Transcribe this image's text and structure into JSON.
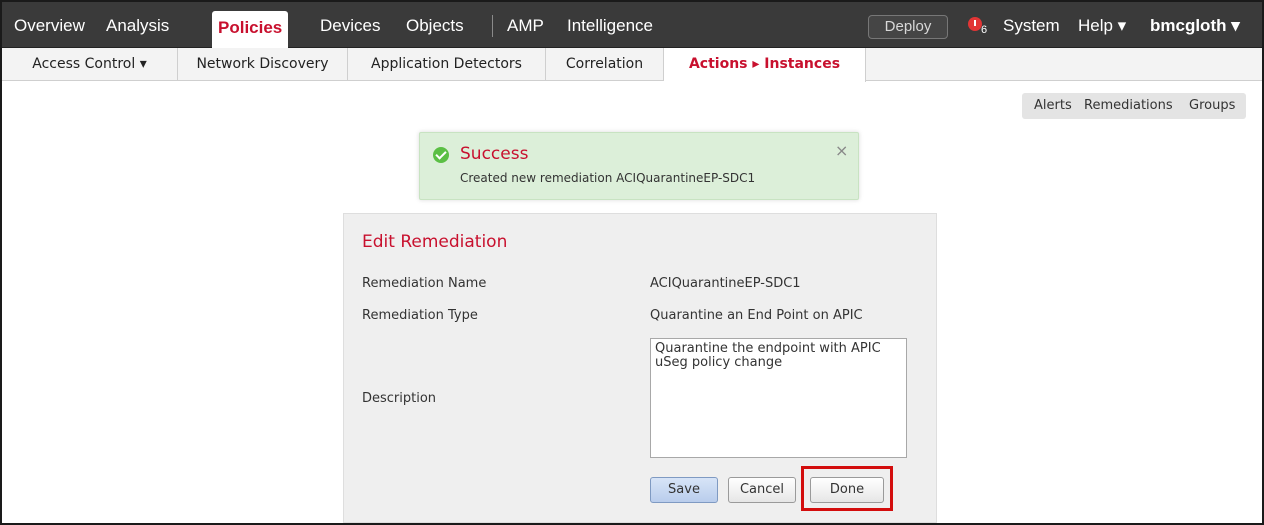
{
  "topnav": {
    "items": [
      "Overview",
      "Analysis",
      "Policies",
      "Devices",
      "Objects",
      "AMP",
      "Intelligence"
    ],
    "active": "Policies",
    "deploy_label": "Deploy",
    "alert_count": "6",
    "system_label": "System",
    "help_label": "Help ▾",
    "user_label": "bmcgloth ▾"
  },
  "subnav": {
    "tabs": [
      "Access Control ▾",
      "Network Discovery",
      "Application Detectors",
      "Correlation",
      "Actions ▸ Instances"
    ],
    "active": "Actions ▸ Instances"
  },
  "page_actions": [
    "Alerts",
    "Remediations",
    "Groups"
  ],
  "success": {
    "title": "Success",
    "message": "Created new remediation ACIQuarantineEP-SDC1",
    "close": "×"
  },
  "form": {
    "title": "Edit Remediation",
    "fields": [
      {
        "label": "Remediation Name",
        "value": "ACIQuarantineEP-SDC1"
      },
      {
        "label": "Remediation Type",
        "value": "Quarantine an End Point on APIC"
      },
      {
        "label": "Description",
        "value": "Quarantine the endpoint with APIC uSeg policy change"
      }
    ],
    "buttons": {
      "save": "Save",
      "cancel": "Cancel",
      "done": "Done"
    }
  },
  "colors": {
    "nav_bg": "#3a3a3a",
    "accent": "#c8102e",
    "success_bg": "#dcefd9",
    "highlight": "#d30d0d"
  },
  "icons": {
    "alert": "alert-icon",
    "success": "check-circle-icon",
    "close": "close-icon"
  }
}
